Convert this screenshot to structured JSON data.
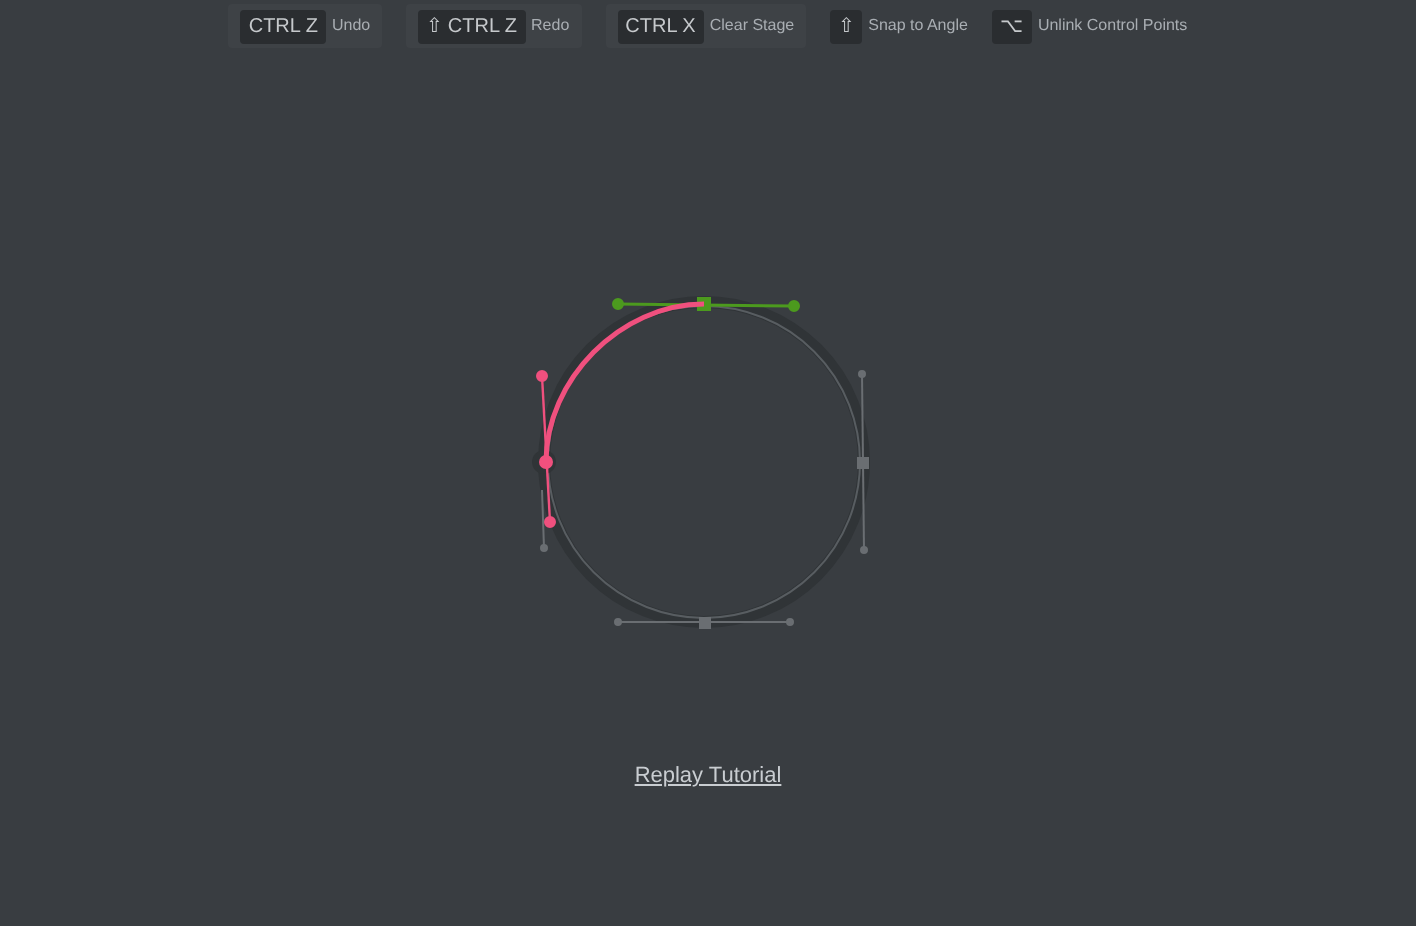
{
  "shortcuts": [
    {
      "key": "CTRL Z",
      "label": "Undo",
      "boxed": true
    },
    {
      "key": "⇧ CTRL Z",
      "label": "Redo",
      "boxed": true
    },
    {
      "key": "CTRL X",
      "label": "Clear Stage",
      "boxed": true
    },
    {
      "key": "⇧",
      "label": "Snap to Angle",
      "boxed": false
    },
    {
      "key": "⌥",
      "label": "Unlink Control Points",
      "boxed": false
    }
  ],
  "link": "Replay Tutorial"
}
